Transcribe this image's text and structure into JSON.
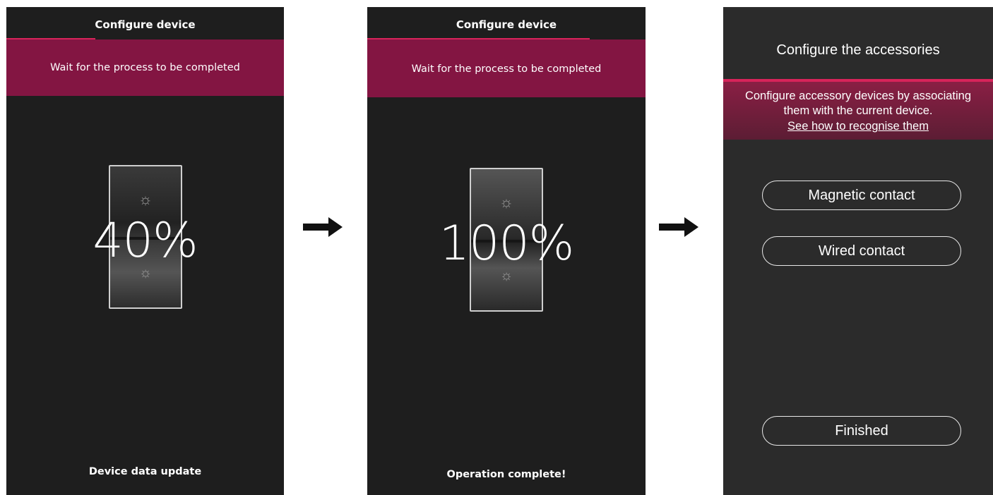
{
  "colors": {
    "accent": "#d8245a",
    "banner": "#831542",
    "background": "#1e1e1e",
    "accessories_background": "#2b2b2b"
  },
  "screen1": {
    "title": "Configure device",
    "banner": "Wait for the process to be completed",
    "progress_percent": 40,
    "percent_label": "40%",
    "footer": "Device data update"
  },
  "screen2": {
    "title": "Configure device",
    "banner": "Wait for the process to be completed",
    "progress_percent": 100,
    "percent_label": "100%",
    "footer": "Operation complete!"
  },
  "screen3": {
    "title": "Configure the accessories",
    "banner_line1": "Configure accessory devices by associating",
    "banner_line2": "them with the current device.",
    "banner_link": "See how to recognise them",
    "buttons": {
      "magnetic": "Magnetic contact",
      "wired": "Wired contact",
      "finished": "Finished"
    }
  },
  "icons": {
    "device_glyph": "light-icon",
    "flow_arrow": "arrow-right-icon"
  }
}
